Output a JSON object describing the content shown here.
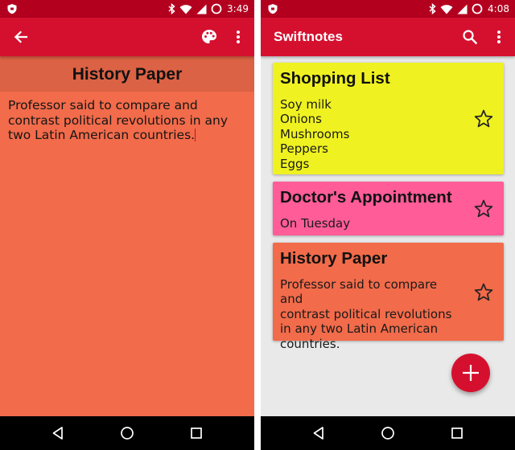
{
  "colors": {
    "status_bar": "#b3001f",
    "app_bar": "#d5102f",
    "note_orange": "#f26b4a",
    "note_yellow": "#eff220",
    "note_pink": "#ff5c98",
    "list_background": "#e9e9e9"
  },
  "left_screen": {
    "status_time": "3:49",
    "note_title": "History Paper",
    "note_body": "Professor said to compare and contrast political revolutions in any two Latin American countries."
  },
  "right_screen": {
    "status_time": "4:08",
    "app_title": "Swiftnotes",
    "notes": [
      {
        "title": "Shopping List",
        "body_lines": [
          "Soy milk",
          "Onions",
          "Mushrooms",
          "Peppers",
          "Eggs"
        ],
        "color": "#eff220",
        "favourite": false
      },
      {
        "title": "Doctor's Appointment",
        "body_lines": [
          "On Tuesday"
        ],
        "color": "#ff5c98",
        "favourite": false
      },
      {
        "title": "History Paper",
        "body_lines": [
          "Professor said to compare and",
          "contrast political revolutions",
          "in any two Latin American",
          "countries."
        ],
        "color": "#f26b4a",
        "favourite": false
      }
    ]
  },
  "icons": {
    "status": [
      "shield-icon",
      "bluetooth-icon",
      "wifi-icon",
      "signal-icon",
      "battery-icon"
    ],
    "left_appbar": [
      "back-arrow-icon",
      "palette-icon",
      "more-vert-icon"
    ],
    "right_appbar": [
      "search-icon",
      "more-vert-icon"
    ],
    "navigation": [
      "nav-back-icon",
      "nav-home-icon",
      "nav-recents-icon"
    ],
    "fab": "plus-icon",
    "card": "star-outline-icon"
  }
}
